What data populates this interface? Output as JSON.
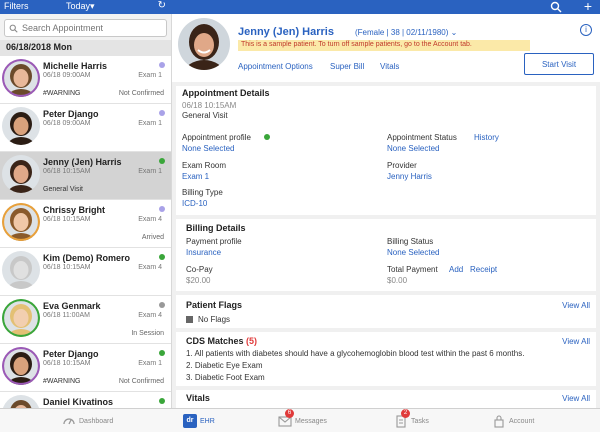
{
  "left_header": {
    "filters_label": "Filters",
    "date_filter": "Today",
    "refresh_icon": "refresh-icon"
  },
  "search": {
    "placeholder": "Search Appointment"
  },
  "date_header": "06/18/2018 Mon",
  "appointments": [
    {
      "name": "Michelle Harris",
      "datetime": "06/18 09:00AM",
      "exam": "Exam 1",
      "dot": "#a9a2e8",
      "note": "#WARNING",
      "status": "Not Confirmed",
      "ring": "#9b59b6",
      "skin": "#e8b89a",
      "hair": "#6b4a2b"
    },
    {
      "name": "Peter Django",
      "datetime": "06/18 09:00AM",
      "exam": "Exam 1",
      "dot": "#a9a2e8",
      "note": "",
      "status": "",
      "ring": "",
      "skin": "#d9a27c",
      "hair": "#2b1d14"
    },
    {
      "name": "Jenny (Jen) Harris",
      "datetime": "06/18 10:15AM",
      "exam": "Exam 1",
      "dot": "#3aa63a",
      "note": "General Visit",
      "status": "",
      "ring": "",
      "skin": "#e0a888",
      "hair": "#3a2418"
    },
    {
      "name": "Chrissy Bright",
      "datetime": "06/18 10:15AM",
      "exam": "Exam 4",
      "dot": "#a9a2e8",
      "note": "",
      "status": "Arrived",
      "ring": "#e8a03a",
      "skin": "#f0c8a8",
      "hair": "#8a5a2b"
    },
    {
      "name": "Kim (Demo) Romero",
      "datetime": "06/18 10:15AM",
      "exam": "Exam 4",
      "dot": "#3aa63a",
      "note": "",
      "status": "",
      "ring": "",
      "skin": "#e0e0e0",
      "hair": "#c8c8c8"
    },
    {
      "name": "Eva Genmark",
      "datetime": "06/18 11:00AM",
      "exam": "Exam 4",
      "dot": "#999999",
      "note": "",
      "status": "In Session",
      "ring": "#3aa63a",
      "skin": "#f2cfb0",
      "hair": "#e3c074"
    },
    {
      "name": "Peter Django",
      "datetime": "06/18 10:15AM",
      "exam": "Exam 1",
      "dot": "#3aa63a",
      "note": "#WARNING",
      "status": "Not Confirmed",
      "ring": "#9b59b6",
      "skin": "#d9a27c",
      "hair": "#2b1d14"
    },
    {
      "name": "Daniel Kivatinos",
      "datetime": "06/18 10:15AM",
      "exam": "",
      "dot": "#3aa63a",
      "note": "",
      "status": "",
      "ring": "",
      "skin": "#e8b89a",
      "hair": "#6b4a2b"
    }
  ],
  "patient": {
    "name": "Jenny (Jen) Harris",
    "info": "(Female | 38 | 02/11/1980)",
    "sample_notice": "This is a sample patient. To turn off sample patients, go to the Account tab.",
    "links": [
      "Appointment Options",
      "Super Bill",
      "Vitals"
    ],
    "start_visit_label": "Start Visit"
  },
  "appointment_details": {
    "title": "Appointment Details",
    "datetime": "06/18 10:15AM",
    "visit_type": "General Visit",
    "profile_label": "Appointment profile",
    "profile_value": "None Selected",
    "status_label": "Appointment Status",
    "history_link": "History",
    "status_value": "None Selected",
    "exam_room_label": "Exam Room",
    "exam_room_value": "Exam 1",
    "provider_label": "Provider",
    "provider_value": "Jenny Harris",
    "billing_type_label": "Billing Type",
    "billing_type_value": "ICD-10"
  },
  "billing_details": {
    "title": "Billing Details",
    "payment_profile_label": "Payment profile",
    "payment_profile_value": "Insurance",
    "billing_status_label": "Billing Status",
    "billing_status_value": "None Selected",
    "copay_label": "Co-Pay",
    "copay_value": "$20.00",
    "total_payment_label": "Total Payment",
    "add_link": "Add",
    "receipt_link": "Receipt",
    "total_payment_value": "$0.00"
  },
  "patient_flags": {
    "title": "Patient Flags",
    "view_all": "View All",
    "no_flags": "No Flags"
  },
  "cds": {
    "title": "CDS Matches",
    "count": "(5)",
    "view_all": "View All",
    "items": [
      "1. All patients with diabetes should have a glycohemoglobin blood test within the past 6 months.",
      "2. Diabetic Eye Exam",
      "3. Diabetic Foot Exam"
    ]
  },
  "vitals": {
    "title": "Vitals",
    "view_all": "View All"
  },
  "tabs": [
    {
      "label": "Dashboard",
      "icon": "dashboard-icon",
      "badge": ""
    },
    {
      "label": "EHR",
      "icon": "dr-icon",
      "badge": ""
    },
    {
      "label": "Messages",
      "icon": "envelope-icon",
      "badge": "6"
    },
    {
      "label": "Tasks",
      "icon": "clipboard-icon",
      "badge": "2"
    },
    {
      "label": "Account",
      "icon": "lock-icon",
      "badge": ""
    }
  ],
  "colors": {
    "brand_blue": "#2a62c0",
    "selected_row": "#d3d3d3",
    "warning_bg": "#fbe9a8",
    "warning_text": "#c0392b",
    "green": "#3aa63a",
    "badge_red": "#e03a3a"
  }
}
